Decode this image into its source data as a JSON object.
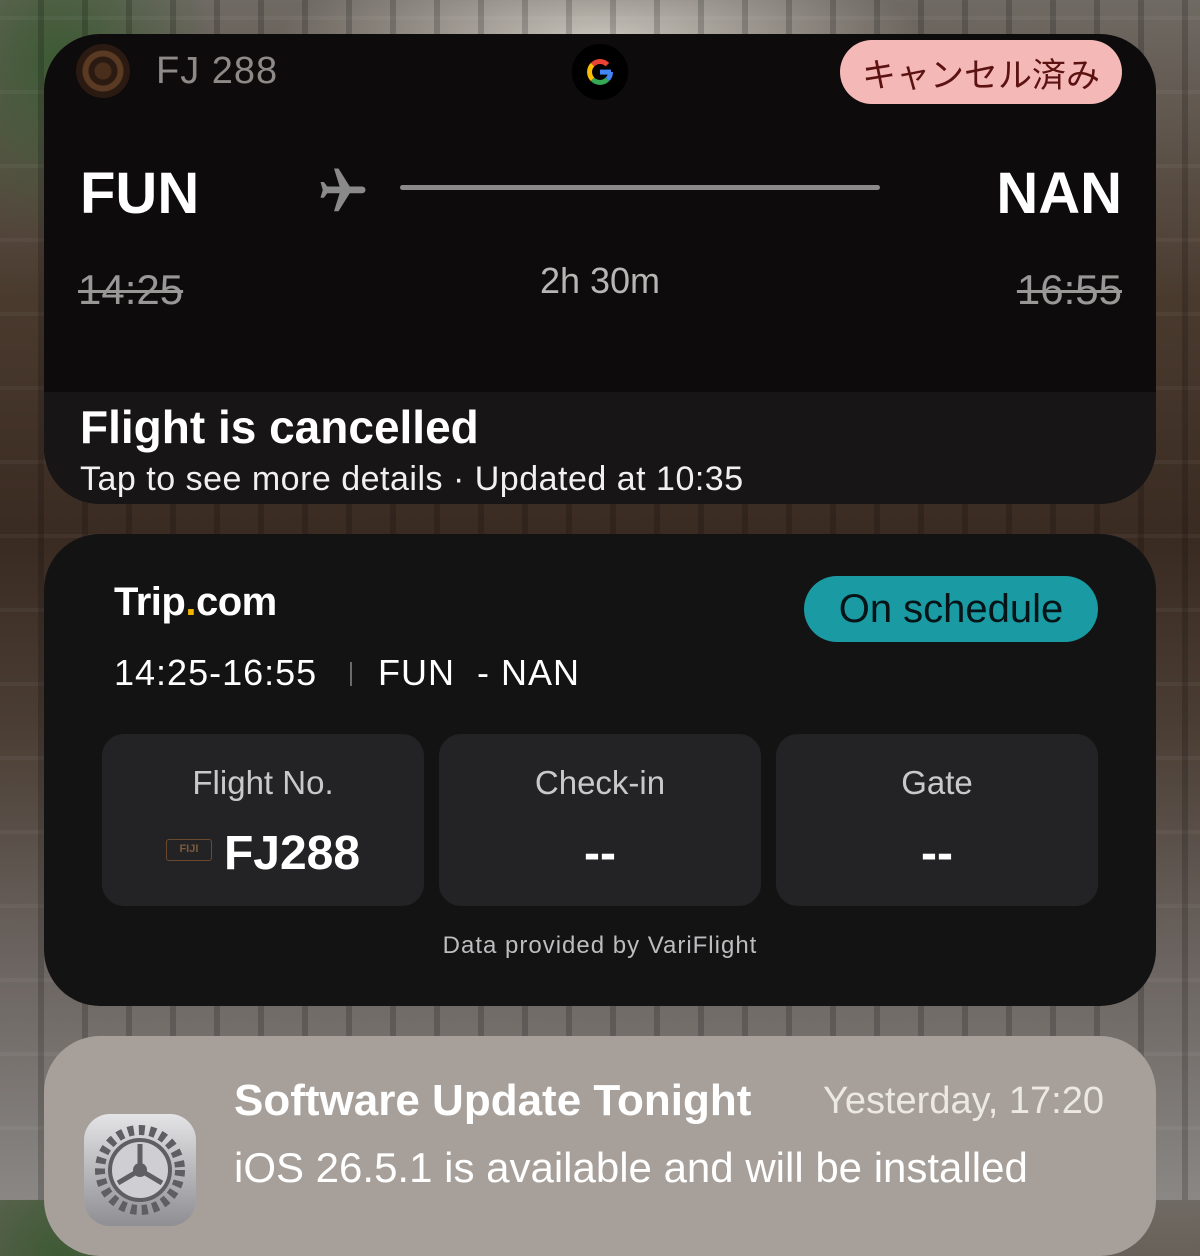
{
  "google_card": {
    "flight_number": "FJ 288",
    "status_badge": "キャンセル済み",
    "origin": "FUN",
    "destination": "NAN",
    "departure_time": "14:25",
    "arrival_time": "16:55",
    "duration": "2h 30m",
    "status_title": "Flight is cancelled",
    "status_subtitle": "Tap to see more details · Updated at 10:35"
  },
  "trip_card": {
    "brand_main": "Trip",
    "brand_dot": ".",
    "brand_tail": "com",
    "status_badge": "On schedule",
    "time_range": "14:25-16:55",
    "route": "FUN  - NAN",
    "boxes": [
      {
        "label": "Flight No.",
        "value": "FJ288",
        "logo_text": "FIJI"
      },
      {
        "label": "Check-in",
        "value": "--"
      },
      {
        "label": "Gate",
        "value": "--"
      }
    ],
    "provider": "Data provided by VariFlight"
  },
  "update_notification": {
    "title": "Software Update Tonight",
    "time": "Yesterday, 17:20",
    "body": "iOS 26.5.1 is available and will be installed"
  },
  "colors": {
    "cancel_badge_bg": "#f4b9b7",
    "schedule_badge_bg": "#1a9aa3",
    "trip_dot": "#f5b400"
  },
  "icons": [
    "fiji-airways-logo",
    "google-logo-icon",
    "airplane-icon",
    "settings-gear-icon"
  ]
}
